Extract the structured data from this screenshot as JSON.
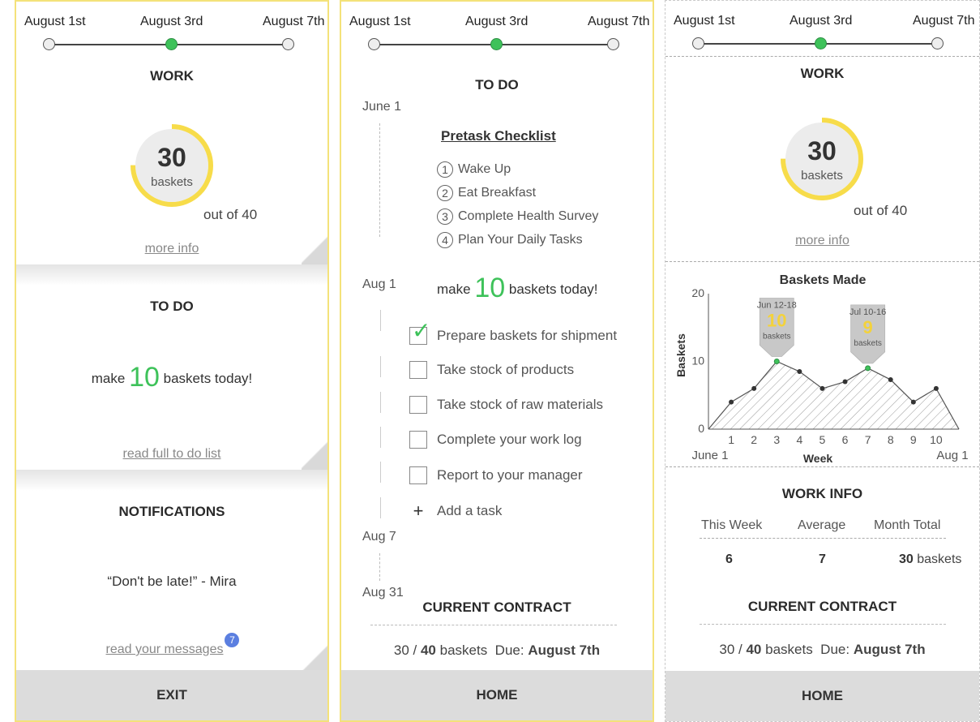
{
  "timeline": {
    "dates": [
      "August 1st",
      "August 3rd",
      "August 7th"
    ]
  },
  "panel1": {
    "work_heading": "WORK",
    "gauge": {
      "value": "30",
      "unit": "baskets",
      "out_of": "out of 40",
      "progress": 0.75
    },
    "more_info": "more info",
    "todo_heading": "TO DO",
    "todo_text_pre": "make",
    "todo_number": "10",
    "todo_text_post": "baskets today!",
    "read_full": "read full to do list",
    "notifications_heading": "NOTIFICATIONS",
    "notification_quote": "“Don't be late!” - Mira",
    "read_messages": "read your messages",
    "messages_badge": "7",
    "exit_label": "EXIT"
  },
  "panel2": {
    "todo_heading": "TO DO",
    "dates": {
      "june1": "June 1",
      "aug1": "Aug 1",
      "aug7": "Aug 7",
      "aug31": "Aug 31"
    },
    "pretask_title": "Pretask Checklist",
    "pretask_steps": [
      {
        "num": "1",
        "label": "Wake Up"
      },
      {
        "num": "2",
        "label": "Eat Breakfast"
      },
      {
        "num": "3",
        "label": "Complete Health Survey"
      },
      {
        "num": "4",
        "label": "Plan Your Daily Tasks"
      }
    ],
    "make_pre": "make",
    "make_number": "10",
    "make_post": "baskets today!",
    "tasks": [
      {
        "label": "Prepare baskets for shipment",
        "checked": true
      },
      {
        "label": "Take stock of products",
        "checked": false
      },
      {
        "label": "Take stock of raw materials",
        "checked": false
      },
      {
        "label": "Complete your work log",
        "checked": false
      },
      {
        "label": "Report to your manager",
        "checked": false
      }
    ],
    "add_task_icon": "+",
    "add_task": "Add a task",
    "contract_heading": "CURRENT CONTRACT",
    "contract_count": "30 /",
    "contract_total": "40",
    "contract_unit": "baskets",
    "due_label": "Due:",
    "due_date": "August 7th",
    "home_label": "HOME"
  },
  "panel3": {
    "work_heading": "WORK",
    "gauge": {
      "value": "30",
      "unit": "baskets",
      "out_of": "out of 40",
      "progress": 0.75
    },
    "more_info": "more info",
    "work_info_heading": "WORK INFO",
    "work_info": {
      "labels": [
        "This Week",
        "Average",
        "Month Total"
      ],
      "values": [
        "6",
        "7",
        "30"
      ],
      "unit": "baskets"
    },
    "contract_heading": "CURRENT CONTRACT",
    "contract_count": "30 /",
    "contract_total": "40",
    "contract_unit": "baskets",
    "due_label": "Due:",
    "due_date": "August 7th",
    "home_label": "HOME"
  },
  "chart_data": {
    "type": "area",
    "title": "Baskets Made",
    "xlabel": "Week",
    "ylabel": "Baskets",
    "x": [
      1,
      2,
      3,
      4,
      5,
      6,
      7,
      8,
      9,
      10
    ],
    "series": [
      {
        "values": [
          4,
          6,
          10,
          8.5,
          6,
          7,
          9,
          7.3,
          4,
          6
        ]
      }
    ],
    "ylim": [
      0,
      20
    ],
    "xlim": [
      0,
      11
    ],
    "yticks": [
      0,
      10,
      20
    ],
    "x_start_label": "June 1",
    "x_end_label": "Aug 1",
    "callouts": [
      {
        "week": 3,
        "range": "Jun 12-18",
        "value": "10",
        "unit": "baskets"
      },
      {
        "week": 7,
        "range": "Jul 10-16",
        "value": "9",
        "unit": "baskets"
      }
    ],
    "colors": {
      "line": "#555555",
      "hatch": "#9a9a9a",
      "marker_highlight": "#3ec25a",
      "callout_bg": "#c8c8c8",
      "callout_num": "#f3d23c"
    }
  },
  "colors": {
    "accent_green": "#3ec25a",
    "gauge_yellow": "#f7dc4a",
    "badge_blue": "#5b7fe0",
    "border_yellow": "#f4e27a"
  }
}
